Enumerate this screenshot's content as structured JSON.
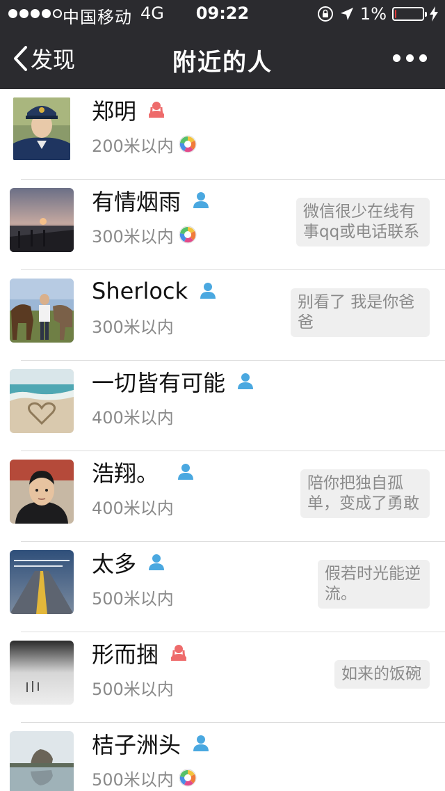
{
  "status_bar": {
    "carrier": "中国移动",
    "network": "4G",
    "time": "09:22",
    "battery_percent_label": "1%",
    "battery_level": 0.01,
    "battery_color": "#e03a3a",
    "signal_bars_filled": 4,
    "signal_bars_total": 5
  },
  "nav": {
    "back_label": "发现",
    "title": "附近的人",
    "more_icon": "ellipsis-icon"
  },
  "colors": {
    "topbar_bg": "#2b2b2f",
    "female_icon": "#ee6b6b",
    "male_icon": "#4aa8e0",
    "signature_bg": "#efefef",
    "distance_text": "#8a8a8a"
  },
  "people": [
    {
      "name": "郑明",
      "gender": "female",
      "distance": "200米以内",
      "signature": "",
      "has_moments": true
    },
    {
      "name": "有情烟雨",
      "gender": "male",
      "distance": "300米以内",
      "signature": "微信很少在线有事qq或电话联系",
      "has_moments": true
    },
    {
      "name": "Sherlock",
      "gender": "male",
      "distance": "300米以内",
      "signature": "别看了  我是你爸爸",
      "has_moments": false
    },
    {
      "name": "一切皆有可能",
      "gender": "male",
      "distance": "400米以内",
      "signature": "",
      "has_moments": false
    },
    {
      "name": "浩翔。",
      "gender": "male",
      "distance": "400米以内",
      "signature": "陪你把独自孤单，变成了勇敢",
      "has_moments": false
    },
    {
      "name": "太多",
      "gender": "male",
      "distance": "500米以内",
      "signature": "假若时光能逆流。",
      "has_moments": false
    },
    {
      "name": "形而捆",
      "gender": "female",
      "distance": "500米以内",
      "signature": "如来的饭碗",
      "has_moments": false
    },
    {
      "name": "桔子洲头",
      "gender": "male",
      "distance": "500米以内",
      "signature": "",
      "has_moments": true
    }
  ]
}
